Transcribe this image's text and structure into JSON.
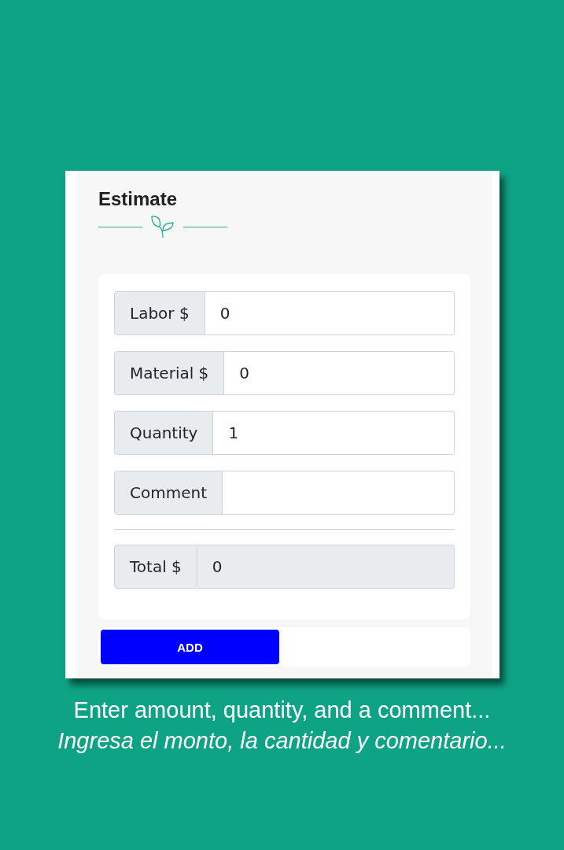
{
  "panel": {
    "title": "Estimate"
  },
  "fields": [
    {
      "label": "Labor $",
      "value": "0",
      "readonly": false
    },
    {
      "label": "Material $",
      "value": "0",
      "readonly": false
    },
    {
      "label": "Quantity",
      "value": "1",
      "readonly": false
    },
    {
      "label": "Comment",
      "readonly": false
    }
  ],
  "total": {
    "label": "Total $",
    "value": "0",
    "readonly": true
  },
  "buttons": [
    "ADD"
  ],
  "caption": {
    "english": "Enter amount, quantity, and a comment...",
    "spanish": "Ingresa el monto, la cantidad y comentario..."
  }
}
